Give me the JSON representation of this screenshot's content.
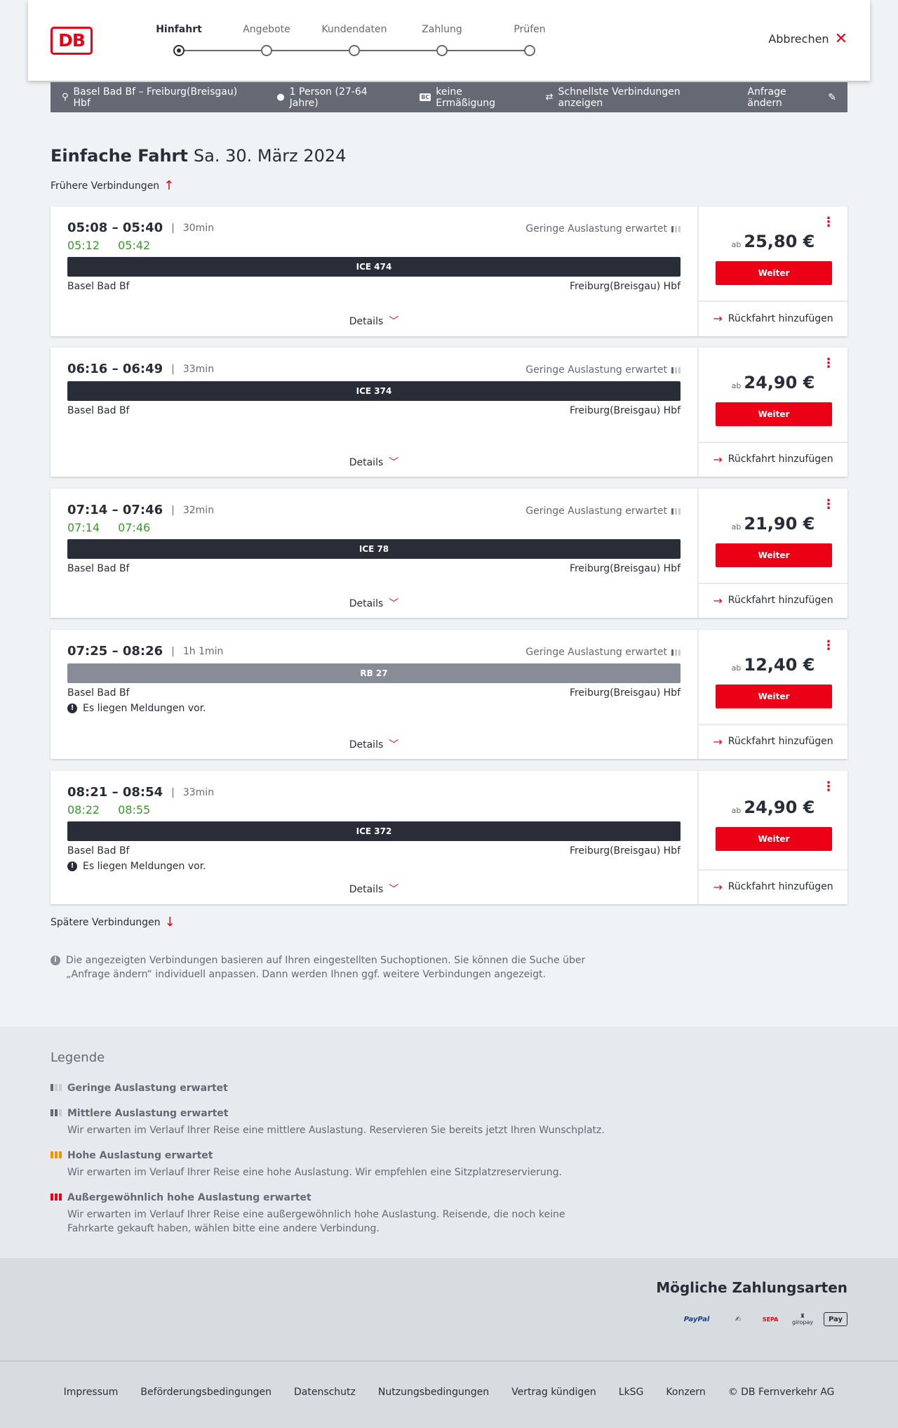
{
  "header": {
    "logo": "DB",
    "steps": [
      {
        "label": "Hinfahrt",
        "active": true
      },
      {
        "label": "Angebote",
        "active": false
      },
      {
        "label": "Kundendaten",
        "active": false
      },
      {
        "label": "Zahlung",
        "active": false
      },
      {
        "label": "Prüfen",
        "active": false
      }
    ],
    "cancel_label": "Abbrechen"
  },
  "summary": {
    "route": "Basel Bad Bf – Freiburg(Breisgau) Hbf",
    "persons": "1 Person (27-64 Jahre)",
    "discount": "keine Ermäßigung",
    "discount_icon": "BC",
    "fastest": "Schnellste Verbindungen anzeigen",
    "change": "Anfrage ändern"
  },
  "title": {
    "main": "Einfache Fahrt",
    "date": "Sa. 30. März 2024"
  },
  "earlier_label": "Frühere Verbindungen",
  "later_label": "Spätere Verbindungen",
  "connections": [
    {
      "dep": "05:08",
      "arr": "05:40",
      "duration": "30min",
      "rt_dep": "05:12",
      "rt_arr": "05:42",
      "load": "Geringe Auslastung erwartet",
      "train": "ICE 474",
      "from": "Basel Bad Bf",
      "to": "Freiburg(Breisgau) Hbf",
      "message": "",
      "details": "Details",
      "price_prefix": "ab",
      "price": "25,80 €",
      "button": "Weiter",
      "return": "Rückfahrt hinzufügen"
    },
    {
      "dep": "06:16",
      "arr": "06:49",
      "duration": "33min",
      "rt_dep": "",
      "rt_arr": "",
      "load": "Geringe Auslastung erwartet",
      "train": "ICE 374",
      "from": "Basel Bad Bf",
      "to": "Freiburg(Breisgau) Hbf",
      "message": "",
      "details": "Details",
      "price_prefix": "ab",
      "price": "24,90 €",
      "button": "Weiter",
      "return": "Rückfahrt hinzufügen"
    },
    {
      "dep": "07:14",
      "arr": "07:46",
      "duration": "32min",
      "rt_dep": "07:14",
      "rt_arr": "07:46",
      "load": "Geringe Auslastung erwartet",
      "train": "ICE 78",
      "from": "Basel Bad Bf",
      "to": "Freiburg(Breisgau) Hbf",
      "message": "",
      "details": "Details",
      "price_prefix": "ab",
      "price": "21,90 €",
      "button": "Weiter",
      "return": "Rückfahrt hinzufügen"
    },
    {
      "dep": "07:25",
      "arr": "08:26",
      "duration": "1h 1min",
      "rt_dep": "",
      "rt_arr": "",
      "load": "Geringe Auslastung erwartet",
      "train": "RB 27",
      "from": "Basel Bad Bf",
      "to": "Freiburg(Breisgau) Hbf",
      "message": "Es liegen Meldungen vor.",
      "details": "Details",
      "price_prefix": "ab",
      "price": "12,40 €",
      "button": "Weiter",
      "return": "Rückfahrt hinzufügen"
    },
    {
      "dep": "08:21",
      "arr": "08:54",
      "duration": "33min",
      "rt_dep": "08:22",
      "rt_arr": "08:55",
      "load": "",
      "train": "ICE 372",
      "from": "Basel Bad Bf",
      "to": "Freiburg(Breisgau) Hbf",
      "message": "Es liegen Meldungen vor.",
      "details": "Details",
      "price_prefix": "ab",
      "price": "24,90 €",
      "button": "Weiter",
      "return": "Rückfahrt hinzufügen"
    }
  ],
  "info_text": "Die angezeigten Verbindungen basieren auf Ihren eingestellten Suchoptionen. Sie können die Suche über „Anfrage ändern“ individuell anpassen. Dann werden Ihnen ggf. weitere Verbindungen angezeigt.",
  "legend": {
    "title": "Legende",
    "items": [
      {
        "title": "Geringe Auslastung erwartet",
        "text": "",
        "color": "#646973"
      },
      {
        "title": "Mittlere Auslastung erwartet",
        "text": "Wir erwarten im Verlauf Ihrer Reise eine mittlere Auslastung. Reservieren Sie bereits jetzt Ihren Wunschplatz.",
        "color": "#646973"
      },
      {
        "title": "Hohe Auslastung erwartet",
        "text": "Wir erwarten im Verlauf Ihrer Reise eine hohe Auslastung. Wir empfehlen eine Sitzplatzreservierung.",
        "color": "#f39200"
      },
      {
        "title": "Außergewöhnlich hohe Auslastung erwartet",
        "text": "Wir erwarten im Verlauf Ihrer Reise eine außergewöhnlich hohe Auslastung. Reisende, die noch keine Fahrkarte gekauft haben, wählen bitte eine andere Verbindung.",
        "color": "#ec0016"
      }
    ]
  },
  "payment": {
    "title": "Mögliche Zahlungsarten",
    "methods": [
      "PayPal",
      "Kreditkarte",
      "SEPA",
      "giropay",
      "Apple Pay"
    ],
    "paypal_label": "PayPal",
    "giropay_label": "giropay",
    "applepay_label": "Pay",
    "sepa_label": "SEPA"
  },
  "footer": {
    "links": [
      "Impressum",
      "Beförderungsbedingungen",
      "Datenschutz",
      "Nutzungsbedingungen",
      "Vertrag kündigen",
      "LkSG",
      "Konzern"
    ],
    "copyright": "© DB Fernverkehr AG"
  },
  "colors": {
    "accent": "#ec0016",
    "realtime": "#3a9a2b",
    "dark": "#282d37"
  }
}
